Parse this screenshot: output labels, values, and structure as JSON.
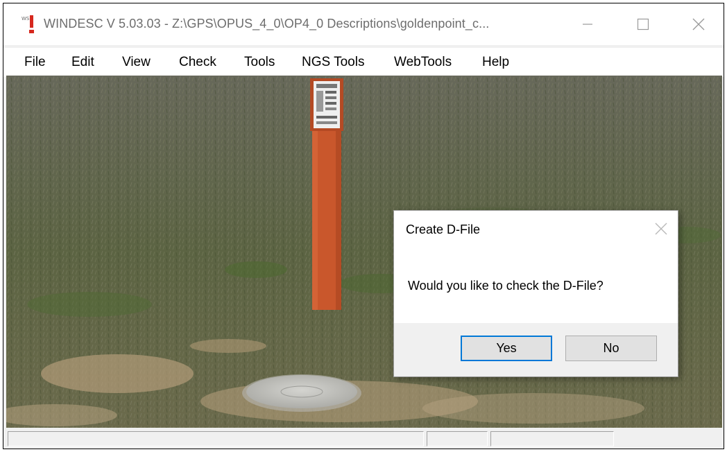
{
  "window": {
    "title": "WINDESC V 5.03.03 - Z:\\GPS\\OPUS_4_0\\OP4_0 Descriptions\\goldenpoint_c...",
    "icon": "windesc-app-icon",
    "controls": [
      "minimize-icon",
      "maximize-icon",
      "close-icon"
    ]
  },
  "menu": {
    "items": [
      {
        "label": "File"
      },
      {
        "label": "Edit"
      },
      {
        "label": "View"
      },
      {
        "label": "Check"
      },
      {
        "label": "Tools"
      },
      {
        "label": "NGS Tools"
      },
      {
        "label": "WebTools"
      },
      {
        "label": "Help"
      }
    ]
  },
  "dialog": {
    "title": "Create D-File",
    "message": "Would you like to check the D-File?",
    "yes_label": "Yes",
    "no_label": "No",
    "default_button": "Yes",
    "accent": "#0078d7"
  },
  "photo": {
    "subject": "orange survey marker post and survey disk in grass field",
    "colors": {
      "grass": "#5d6646",
      "post": "#c9572c",
      "soil": "#b9a07c"
    }
  }
}
